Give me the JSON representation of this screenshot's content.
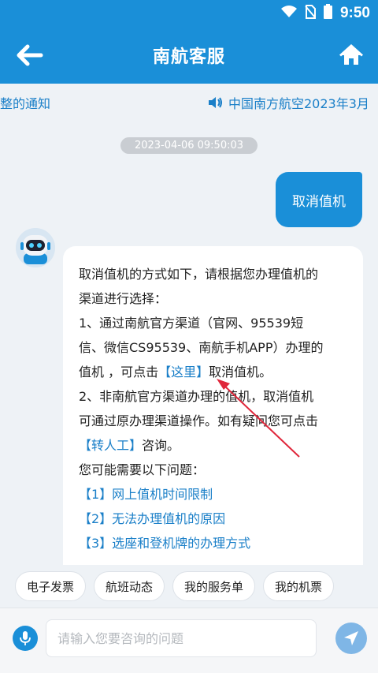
{
  "status_bar": {
    "time": "9:50"
  },
  "header": {
    "title": "南航客服"
  },
  "notice": {
    "text_left": "整的通知",
    "text_right": "中国南方航空2023年3月"
  },
  "chat": {
    "timestamp": "2023-04-06 09:50:03",
    "user_message": "取消值机",
    "bot": {
      "line1": "取消值机的方式如下，请根据您办理值机的",
      "line2": "渠道进行选择：",
      "line3": "1、通过南航官方渠道（官网、95539短",
      "line4": "信、微信CS95539、南航手机APP）办理的",
      "line5_prefix": "值机 ，可点击",
      "line5_link": "【这里】",
      "line5_suffix": "取消值机。",
      "line6": "2、非南航官方渠道办理的值机，取消值机",
      "line7": "可通过原办理渠道操作。如有疑问您可点击",
      "line8_link": "【转人工】",
      "line8_suffix": "咨询。",
      "line9": "您可能需要以下问题：",
      "q1": "【1】网上值机时间限制",
      "q2": "【2】无法办理值机的原因",
      "q3": "【3】选座和登机牌的办理方式"
    }
  },
  "quick_chips": [
    "电子发票",
    "航班动态",
    "我的服务单",
    "我的机票"
  ],
  "input": {
    "placeholder": "请输入您要咨询的问题"
  },
  "colors": {
    "primary": "#1a8fd8",
    "link": "#1a7fc8",
    "arrow": "#e0263a"
  }
}
